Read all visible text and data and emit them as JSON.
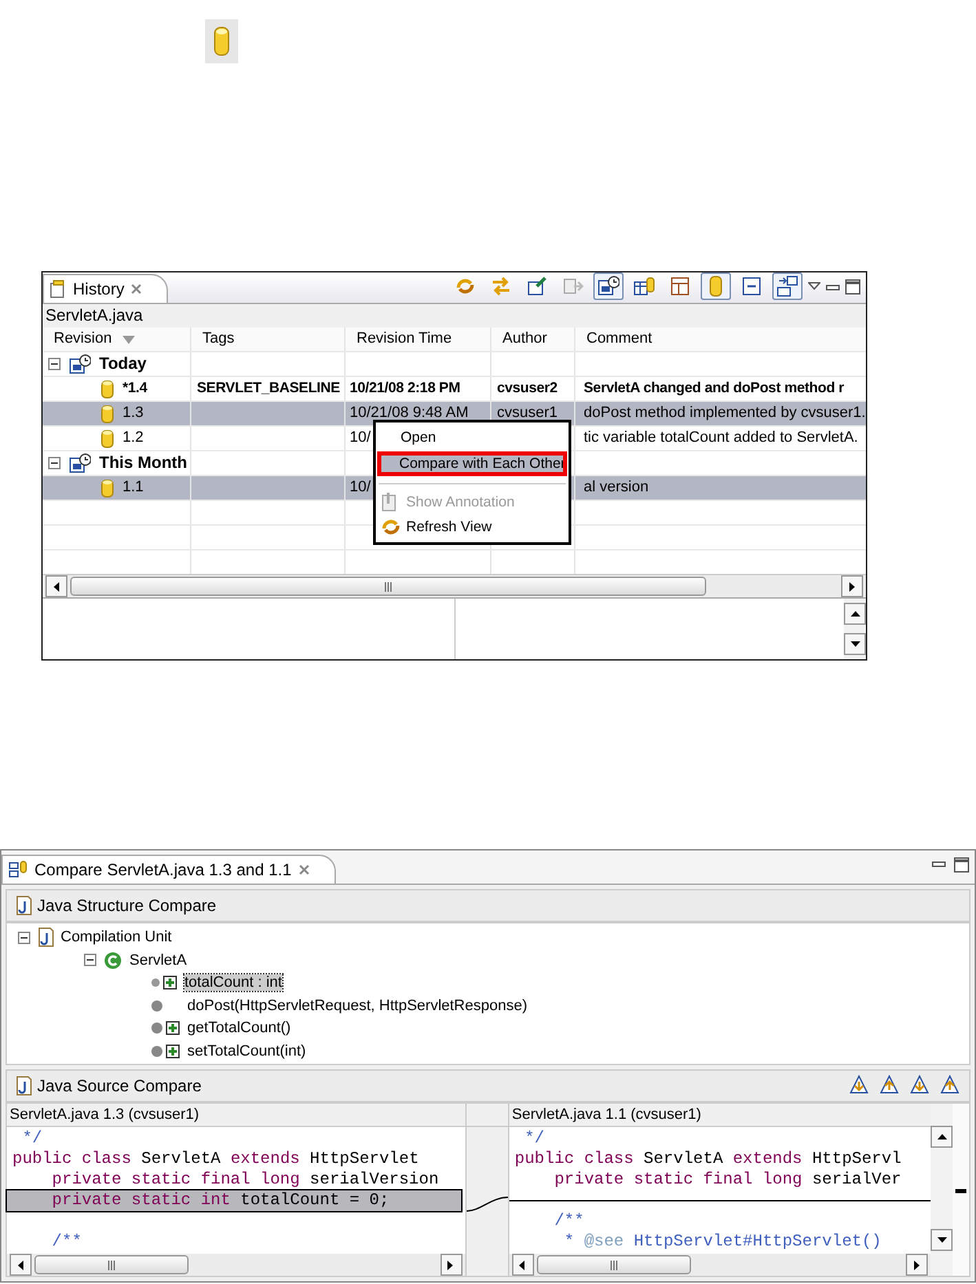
{
  "history": {
    "tab": {
      "label": "History",
      "selected": true
    },
    "toolbar": [
      {
        "kind": "refresh",
        "pressed": false
      },
      {
        "kind": "link",
        "pressed": false
      },
      {
        "kind": "pin",
        "pressed": false
      },
      {
        "kind": "compare-menu",
        "pressed": false
      },
      {
        "kind": "group-by-date",
        "pressed": true
      },
      {
        "kind": "local-remote",
        "pressed": false
      },
      {
        "kind": "table",
        "pressed": false
      },
      {
        "kind": "remote",
        "pressed": true
      },
      {
        "kind": "collapse",
        "pressed": false
      },
      {
        "kind": "layout",
        "pressed": true
      }
    ],
    "file": "ServletA.java",
    "columns": [
      "Revision",
      "Tags",
      "Revision Time",
      "Author",
      "Comment"
    ],
    "groups": [
      {
        "label": "Today",
        "expanded": true,
        "rows": [
          {
            "revision": "*1.4",
            "tags": "SERVLET_BASELINE",
            "time": "10/21/08 2:18 PM",
            "author": "cvsuser2",
            "comment": "ServletA changed and doPost method r",
            "current": true,
            "selected": false
          },
          {
            "revision": "1.3",
            "time": "10/21/08 9:48 AM",
            "author": "cvsuser1",
            "comment": "doPost method implemented by cvsuser1.",
            "current": false,
            "selected": true
          },
          {
            "revision": "1.2",
            "time": "10/",
            "comment": "tic variable totalCount added to ServletA.",
            "current": false,
            "selected": false
          }
        ]
      },
      {
        "label": "This Month",
        "expanded": true,
        "rows": [
          {
            "revision": "1.1",
            "time": "10/",
            "comment": "al version",
            "current": false,
            "selected": true
          }
        ]
      }
    ],
    "context_menu": [
      {
        "kind": "plain",
        "label": "Open",
        "disabled": false,
        "selected": false
      },
      {
        "kind": "plain",
        "label": "Compare with Each Other",
        "disabled": false,
        "selected": true
      },
      {
        "kind": "separator"
      },
      {
        "kind": "annotate",
        "label": "Show Annotation",
        "disabled": true,
        "selected": false
      },
      {
        "kind": "refresh",
        "label": "Refresh View",
        "disabled": false,
        "selected": false
      }
    ]
  },
  "compare": {
    "tab": {
      "label": "Compare ServletA.java 1.3 and 1.1",
      "selected": true
    },
    "structure": {
      "title": "Java Structure Compare",
      "tree": [
        {
          "label": "Compilation Unit",
          "kind": "unit",
          "expanded": true,
          "selected": false,
          "children": [
            {
              "label": "ServletA",
              "kind": "class",
              "expanded": true,
              "selected": false,
              "children": [
                {
                  "label": "totalCount : int",
                  "kind": "added-field",
                  "selected": true
                },
                {
                  "label": "doPost(HttpServletRequest, HttpServletResponse)",
                  "kind": "changed-method",
                  "selected": false
                },
                {
                  "label": "getTotalCount()",
                  "kind": "added-method",
                  "selected": false
                },
                {
                  "label": "setTotalCount(int)",
                  "kind": "added-method",
                  "selected": false
                }
              ]
            }
          ]
        }
      ]
    },
    "source": {
      "title": "Java Source Compare",
      "left": {
        "header": "ServletA.java 1.3 (cvsuser1)",
        "lines": [
          {
            "kind": "code",
            "changed": false,
            "parts": [
              {
                "kind": "comment",
                "text": " */"
              }
            ]
          },
          {
            "kind": "code",
            "changed": false,
            "parts": [
              {
                "kind": "keyword",
                "text": "public class"
              },
              {
                "kind": "plain",
                "text": " ServletA "
              },
              {
                "kind": "keyword",
                "text": "extends"
              },
              {
                "kind": "plain",
                "text": " HttpServlet"
              }
            ]
          },
          {
            "kind": "code",
            "changed": false,
            "parts": [
              {
                "kind": "keyword",
                "text": "    private static final long"
              },
              {
                "kind": "plain",
                "text": " serialVersion"
              }
            ]
          },
          {
            "kind": "code",
            "changed": true,
            "parts": [
              {
                "kind": "keyword",
                "text": "    private static int"
              },
              {
                "kind": "plain",
                "text": " totalCount = 0;"
              }
            ]
          },
          {
            "kind": "blank"
          },
          {
            "kind": "code",
            "changed": false,
            "parts": [
              {
                "kind": "comment",
                "text": "    /**"
              }
            ]
          }
        ]
      },
      "right": {
        "header": "ServletA.java 1.1 (cvsuser1)",
        "lines": [
          {
            "kind": "code",
            "changed": false,
            "parts": [
              {
                "kind": "comment",
                "text": " */"
              }
            ]
          },
          {
            "kind": "code",
            "changed": false,
            "parts": [
              {
                "kind": "keyword",
                "text": "public class"
              },
              {
                "kind": "plain",
                "text": " ServletA "
              },
              {
                "kind": "keyword",
                "text": "extends"
              },
              {
                "kind": "plain",
                "text": " HttpServl"
              }
            ]
          },
          {
            "kind": "code",
            "changed": false,
            "parts": [
              {
                "kind": "keyword",
                "text": "    private static final long"
              },
              {
                "kind": "plain",
                "text": " serialVer"
              }
            ]
          },
          {
            "kind": "gap"
          },
          {
            "kind": "code",
            "changed": false,
            "parts": [
              {
                "kind": "comment",
                "text": "    /**"
              }
            ]
          },
          {
            "kind": "code",
            "changed": false,
            "parts": [
              {
                "kind": "comment",
                "text": "     * "
              },
              {
                "kind": "tag",
                "text": "@see"
              },
              {
                "kind": "doc",
                "text": " HttpServlet#HttpServlet()"
              }
            ]
          }
        ]
      }
    }
  }
}
